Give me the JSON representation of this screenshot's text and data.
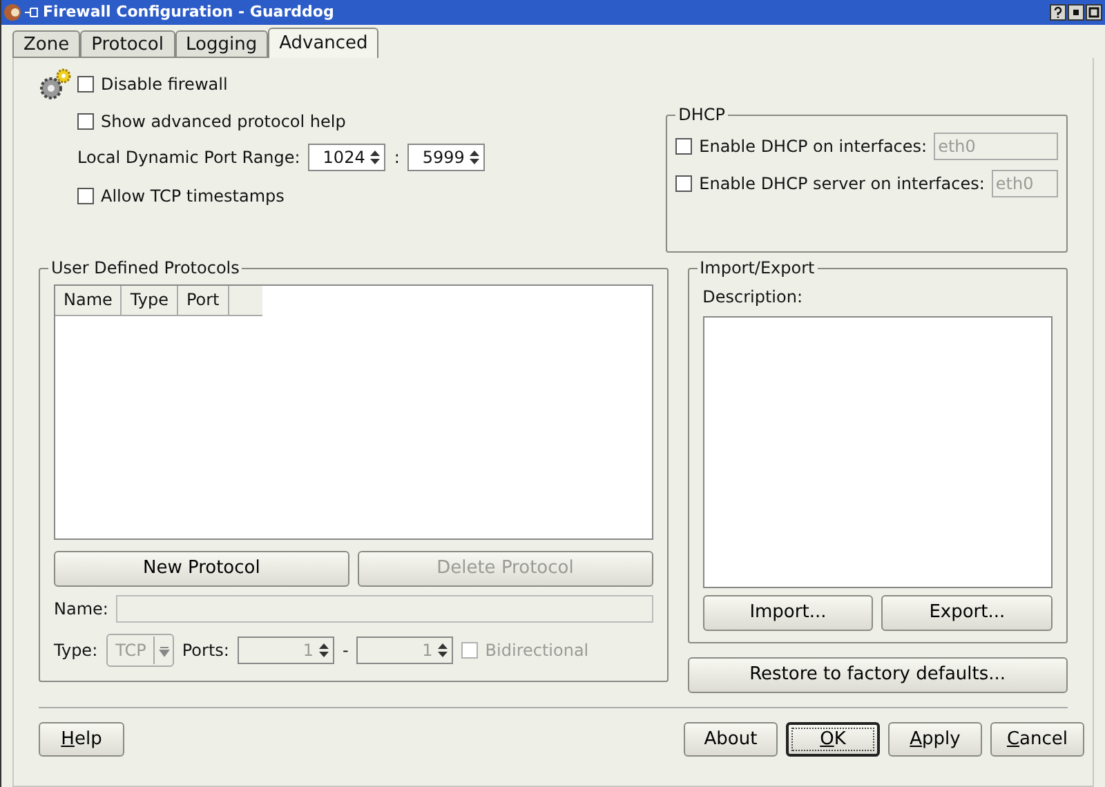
{
  "window": {
    "title": "Firewall Configuration - Guarddog"
  },
  "tabs": [
    {
      "label": "Zone",
      "selected": false
    },
    {
      "label": "Protocol",
      "selected": false
    },
    {
      "label": "Logging",
      "selected": false
    },
    {
      "label": "Advanced",
      "selected": true
    }
  ],
  "options": [
    {
      "label": "Disable firewall",
      "checked": false
    },
    {
      "label": "Show advanced protocol help",
      "checked": false
    }
  ],
  "port_range": {
    "label": "Local Dynamic Port Range:",
    "from": "1024",
    "separator": ":",
    "to": "5999"
  },
  "tcp_timestamps": {
    "label": "Allow TCP timestamps",
    "checked": false
  },
  "dhcp": {
    "title": "DHCP",
    "rows": [
      {
        "label": "Enable DHCP on interfaces:",
        "checked": false,
        "value": "eth0",
        "disabled": true
      },
      {
        "label": "Enable DHCP server on interfaces:",
        "checked": false,
        "value": "eth0",
        "disabled": true
      }
    ]
  },
  "protocols": {
    "title": "User Defined Protocols",
    "columns": [
      "Name",
      "Type",
      "Port"
    ],
    "buttons": [
      {
        "label": "New Protocol",
        "disabled": false
      },
      {
        "label": "Delete Protocol",
        "disabled": true
      }
    ],
    "name_label": "Name:",
    "type_label": "Type:",
    "type_value": "TCP",
    "type_disabled": true,
    "ports_label": "Ports:",
    "port_from": "1",
    "port_sep": "-",
    "port_to": "1",
    "ports_disabled": true,
    "bidirectional": {
      "label": "Bidirectional",
      "checked": false,
      "disabled": true
    }
  },
  "import_export": {
    "title": "Import/Export",
    "description_label": "Description:",
    "buttons": [
      "Import...",
      "Export..."
    ]
  },
  "restore_button": "Restore to factory defaults...",
  "footer": {
    "left": [
      {
        "label": "Help",
        "mnemonic": true,
        "default": false
      }
    ],
    "right": [
      {
        "label": "About",
        "mnemonic": false,
        "default": false
      },
      {
        "label": "OK",
        "mnemonic": true,
        "default": true
      },
      {
        "label": "Apply",
        "mnemonic": true,
        "default": false
      },
      {
        "label": "Cancel",
        "mnemonic": true,
        "default": false
      }
    ]
  }
}
